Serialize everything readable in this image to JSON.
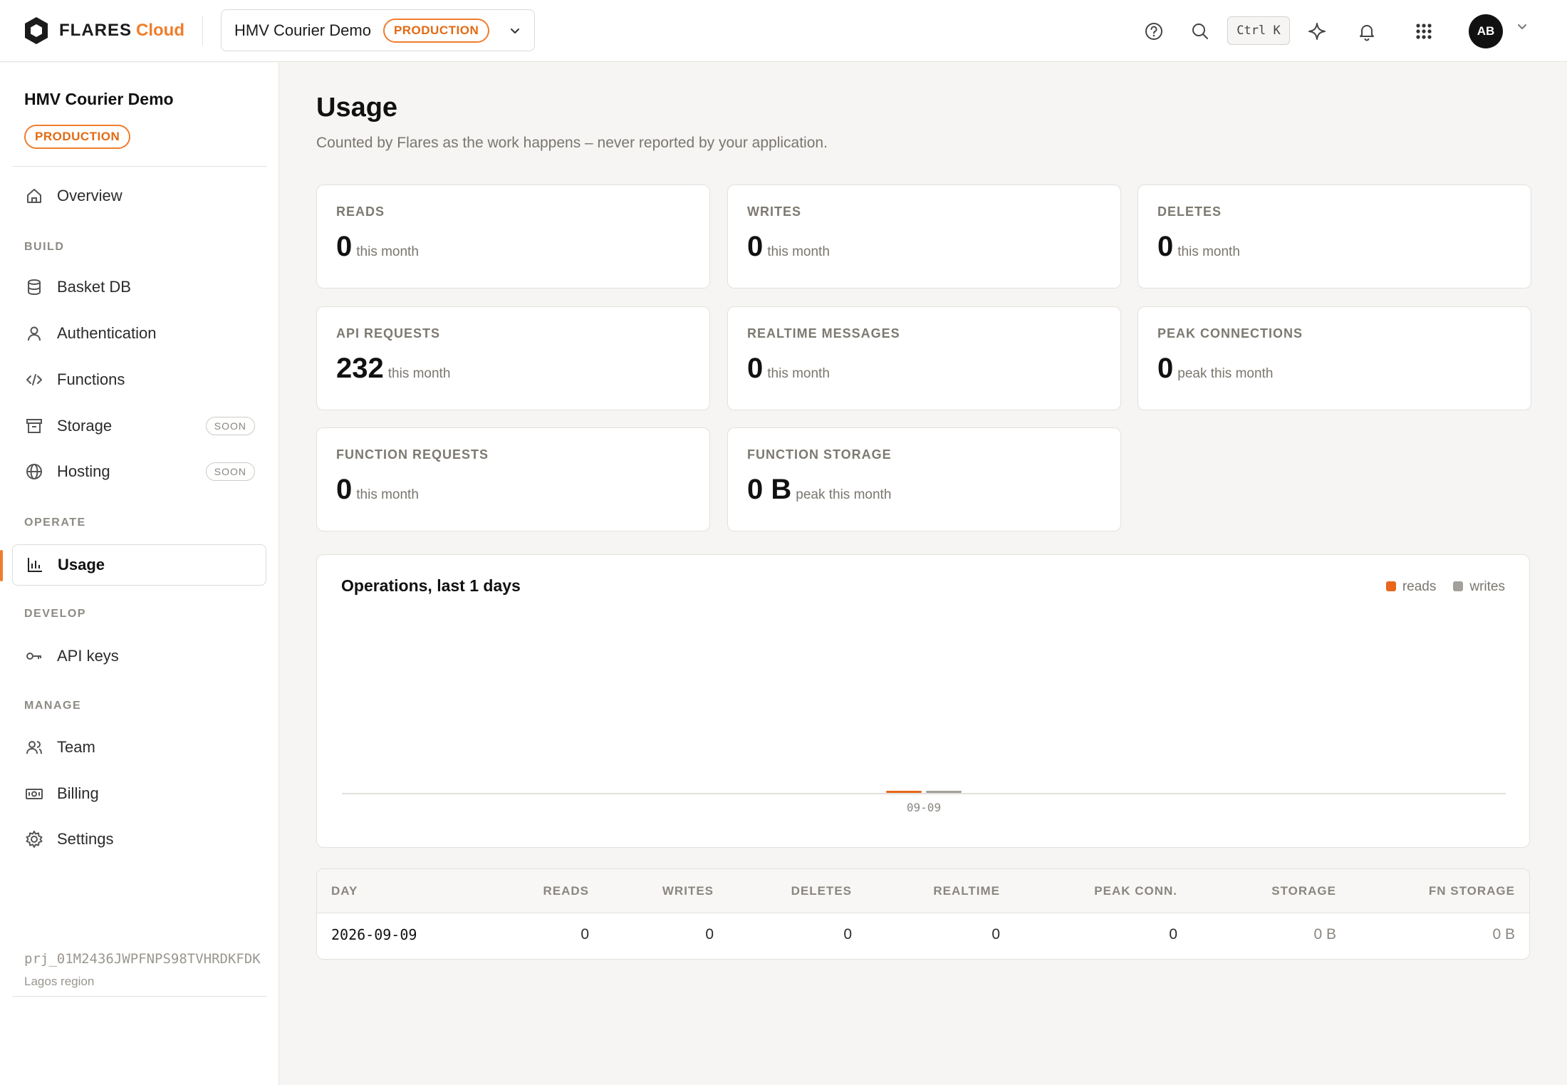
{
  "brand": {
    "name": "FLARES",
    "suffix": "Cloud"
  },
  "project": {
    "name": "HMV Courier Demo",
    "env": "PRODUCTION",
    "id": "prj_01M2436JWPFNPS98TVHRDKFDK",
    "region": "Lagos region"
  },
  "topbar": {
    "shortcut": "Ctrl K",
    "avatar": "AB"
  },
  "sidebar": {
    "overview": "Overview",
    "sections": {
      "build": "BUILD",
      "operate": "OPERATE",
      "develop": "DEVELOP",
      "manage": "MANAGE"
    },
    "items": {
      "basket_db": "Basket DB",
      "authentication": "Authentication",
      "functions": "Functions",
      "storage": "Storage",
      "hosting": "Hosting",
      "usage": "Usage",
      "api_keys": "API keys",
      "team": "Team",
      "billing": "Billing",
      "settings": "Settings"
    },
    "soon_badge": "SOON"
  },
  "page": {
    "title": "Usage",
    "subtitle": "Counted by Flares as the work happens – never reported by your application."
  },
  "metrics": [
    {
      "label": "READS",
      "value": "0",
      "unit": "this month"
    },
    {
      "label": "WRITES",
      "value": "0",
      "unit": "this month"
    },
    {
      "label": "DELETES",
      "value": "0",
      "unit": "this month"
    },
    {
      "label": "API REQUESTS",
      "value": "232",
      "unit": "this month"
    },
    {
      "label": "REALTIME MESSAGES",
      "value": "0",
      "unit": "this month"
    },
    {
      "label": "PEAK CONNECTIONS",
      "value": "0",
      "unit": "peak this month"
    },
    {
      "label": "FUNCTION REQUESTS",
      "value": "0",
      "unit": "this month"
    },
    {
      "label": "FUNCTION STORAGE",
      "value": "0 B",
      "unit": "peak this month"
    }
  ],
  "chart": {
    "title": "Operations, last 1 days",
    "legend": {
      "reads": "reads",
      "writes": "writes"
    },
    "colors": {
      "reads": "#e8671a",
      "writes": "#a3a09b"
    }
  },
  "chart_data": {
    "type": "bar",
    "title": "Operations, last 1 days",
    "categories": [
      "09-09"
    ],
    "series": [
      {
        "name": "reads",
        "values": [
          0
        ]
      },
      {
        "name": "writes",
        "values": [
          0
        ]
      }
    ],
    "legend_position": "top-right",
    "grid": false
  },
  "table": {
    "headers": [
      "DAY",
      "READS",
      "WRITES",
      "DELETES",
      "REALTIME",
      "PEAK CONN.",
      "STORAGE",
      "FN STORAGE"
    ],
    "rows": [
      [
        "2026-09-09",
        "0",
        "0",
        "0",
        "0",
        "0",
        "0 B",
        "0 B"
      ]
    ]
  }
}
